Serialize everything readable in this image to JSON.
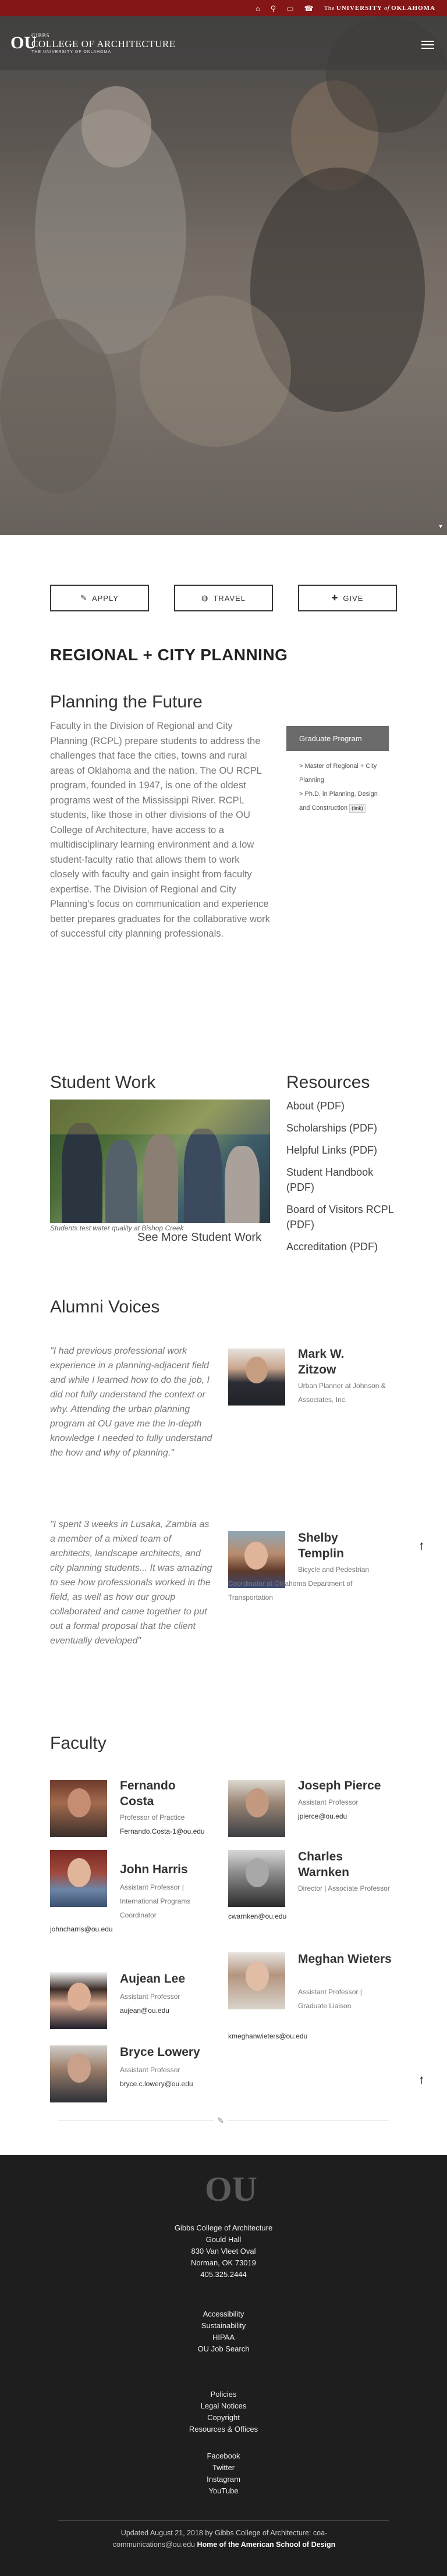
{
  "utility_bar": {
    "icons": [
      "home-icon",
      "search-icon",
      "monitor-icon",
      "phone-icon"
    ],
    "university_prefix": "The",
    "university_name": "UNIVERSITY",
    "university_of": "of",
    "university_state": "OKLAHOMA"
  },
  "header": {
    "logo_mark": "OU",
    "logo_line1": "GIBBS",
    "logo_line2": "COLLEGE OF ARCHITECTURE",
    "logo_line3": "THE UNIVERSITY OF OKLAHOMA"
  },
  "actions": [
    {
      "label": "APPLY",
      "icon": "pencil-icon",
      "glyph": "✎"
    },
    {
      "label": "TRAVEL",
      "icon": "globe-icon",
      "glyph": "◍"
    },
    {
      "label": "GIVE",
      "icon": "gift-icon",
      "glyph": "✚"
    }
  ],
  "page_title": "REGIONAL + CITY PLANNING",
  "planning": {
    "heading": "Planning the Future",
    "body": "Faculty in the Division of Regional and City Planning (RCPL) prepare students to address the challenges that face the cities, towns and rural areas of Oklahoma and the nation. The OU RCPL program, founded in 1947, is one of the oldest programs west of the Mississippi River. RCPL students, like those in other divisions of the OU College of Architecture, have access to a multidisciplinary learning environment and a low student-faculty ratio that allows them to work closely with faculty and gain insight from faculty expertise. The Division of Regional and City Planning's focus on communication and experience better prepares graduates for the collaborative work of successful city planning professionals.",
    "graduate_button": "Graduate Program",
    "graduate_links": [
      "> Master of Regional + City Planning",
      "> Ph.D. in Planning, Design and Construction"
    ],
    "external_tag": "(link)"
  },
  "student_work": {
    "heading": "Student Work",
    "caption": "Students test water quality at Bishop Creek",
    "see_more": "See More Student Work"
  },
  "resources": {
    "heading": "Resources",
    "items": [
      "About (PDF)",
      "Scholarships (PDF)",
      "Helpful Links (PDF)",
      "Student Handbook (PDF)",
      "Board of Visitors RCPL (PDF)",
      "Accreditation (PDF)"
    ]
  },
  "alumni": {
    "heading": "Alumni Voices",
    "voices": [
      {
        "quote": "\"I had previous professional work experience in a planning-adjacent field and while I learned how to do the job, I did not fully understand the context or why. Attending the urban planning program at OU gave me the in-depth knowledge I needed to fully understand the how and why of planning.\"",
        "name_first": "Mark W.",
        "name_last": "Zitzow",
        "role": "Urban Planner at Johnson & Associates, Inc."
      },
      {
        "quote": "\"I spent 3 weeks in Lusaka, Zambia as a member of a mixed team of architects, landscape architects, and city planning students... It was amazing to see how professionals worked in the field, as well as how our group collaborated and came together to put out a formal proposal that the client eventually developed\"",
        "name_first": "Shelby",
        "name_last": "Templin",
        "role": "Bicycle and Pedestrian Coordinator at Oklahoma Department of Transportation"
      }
    ]
  },
  "faculty": {
    "heading": "Faculty",
    "members": [
      {
        "name": "Fernando Costa",
        "role": "Professor of Practice",
        "email": "Fernando.Costa-1@ou.edu"
      },
      {
        "name": "Joseph Pierce",
        "role": "Assistant Professor",
        "email": "jpierce@ou.edu"
      },
      {
        "name": "John Harris",
        "role": "Assistant Professor | International Programs Coordinator",
        "email": "johncharris@ou.edu"
      },
      {
        "name": "Charles Warnken",
        "role": "Director | Associate Professor",
        "email": "cwarnken@ou.edu"
      },
      {
        "name": "Aujean Lee",
        "role": "Assistant Professor",
        "email": "aujean@ou.edu"
      },
      {
        "name": "Meghan Wieters",
        "role": "Assistant Professor | Graduate Liaison",
        "email": "kmeghanwieters@ou.edu"
      },
      {
        "name": "Bryce Lowery",
        "role": "Assistant Professor",
        "email": "bryce.c.lowery@ou.edu"
      }
    ]
  },
  "footer": {
    "logo_mark": "OU",
    "address": [
      "Gibbs College of Architecture",
      "Gould Hall",
      "830 Van Vleet Oval",
      "Norman, OK 73019",
      "405.325.2444"
    ],
    "links1": [
      "Accessibility",
      "Sustainability",
      "HIPAA",
      "OU Job Search"
    ],
    "links2": [
      "Policies",
      "Legal Notices",
      "Copyright",
      "Resources & Offices"
    ],
    "social": [
      "Facebook",
      "Twitter",
      "Instagram",
      "YouTube"
    ],
    "updated": "Updated August 21, 2018 by Gibbs College of Architecture: coa-communications@ou.edu",
    "tagline": "Home of the American School of Design"
  }
}
